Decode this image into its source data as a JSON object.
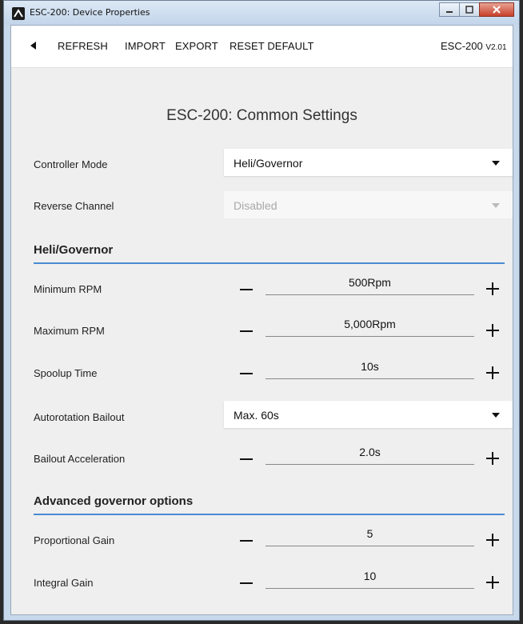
{
  "window": {
    "title": "ESC-200: Device Properties"
  },
  "toolbar": {
    "refresh": "REFRESH",
    "import": "IMPORT",
    "export": "EXPORT",
    "reset": "RESET DEFAULT",
    "model": "ESC-200",
    "version": "V2.01"
  },
  "page": {
    "title": "ESC-200: Common Settings"
  },
  "common": {
    "controller_mode": {
      "label": "Controller Mode",
      "value": "Heli/Governor"
    },
    "reverse_channel": {
      "label": "Reverse Channel",
      "value": "Disabled"
    }
  },
  "heli": {
    "header": "Heli/Governor",
    "min_rpm": {
      "label": "Minimum RPM",
      "value": "500Rpm"
    },
    "max_rpm": {
      "label": "Maximum RPM",
      "value": "5,000Rpm"
    },
    "spoolup": {
      "label": "Spoolup Time",
      "value": "10s"
    },
    "autorotation": {
      "label": "Autorotation Bailout",
      "value": "Max. 60s"
    },
    "bailout_accel": {
      "label": "Bailout Acceleration",
      "value": "2.0s"
    }
  },
  "advanced": {
    "header": "Advanced governor options",
    "p_gain": {
      "label": "Proportional Gain",
      "value": "5"
    },
    "i_gain": {
      "label": "Integral Gain",
      "value": "10"
    }
  }
}
